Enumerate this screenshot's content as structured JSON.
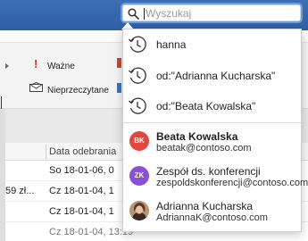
{
  "search": {
    "placeholder": "Wyszukaj"
  },
  "ribbon": {
    "important_label": "Ważne",
    "unread_label": "Nieprzeczytane"
  },
  "message_list": {
    "column_header": "Data odebrania",
    "rows": [
      {
        "amount": "",
        "date": "So 18-01-06, 0"
      },
      {
        "amount": "59 zł...",
        "date": "Cz 18-01-04, 1"
      },
      {
        "amount": "",
        "date": "Cz 18-01-04, 1"
      },
      {
        "amount": "",
        "date": "Cz 18-01-04, 13:19"
      }
    ]
  },
  "suggestions": {
    "recent_searches": [
      {
        "text": "hanna",
        "icon": "clock-icon"
      },
      {
        "text": "od:\"Adrianna Kucharska\"",
        "icon": "clock-icon"
      },
      {
        "text": "od:\"Beata Kowalska\"",
        "icon": "clock-icon"
      }
    ],
    "contacts": [
      {
        "name": "Beata Kowalska",
        "email": "beatak@contoso.com",
        "initials": "BK",
        "color": "#e3463d",
        "bold": true
      },
      {
        "name": "Zespół ds. konferencji",
        "email": "zespoldskonferencji@contoso.com",
        "initials": "ZK",
        "color": "#8a4fd3",
        "bold": false
      },
      {
        "name": "Adrianna Kucharska",
        "email": "AdriannaK@contoso.com",
        "initials": "",
        "color": "#c9a98c",
        "bold": false
      }
    ]
  },
  "colors": {
    "title_bar": "#3d6fb5",
    "search_focus": "#6f9ce0"
  }
}
